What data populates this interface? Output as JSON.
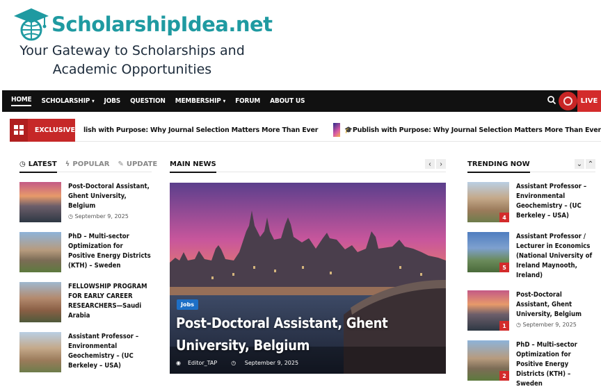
{
  "site": {
    "logo_text": "ScholarshipIdea.net",
    "tagline_line1": "Your Gateway to Scholarships and",
    "tagline_line2": "Academic Opportunities"
  },
  "nav": {
    "items": [
      "HOME",
      "SCHOLARSHIP",
      "JOBS",
      "QUESTION",
      "MEMBERSHIP",
      "FORUM",
      "ABOUT US"
    ],
    "live_label": "LIVE"
  },
  "ticker": {
    "badge": "EXCLUSIVE",
    "text1": "lish with Purpose: Why Journal Selection Matters More Than Ever",
    "text2": "Publish with Purpose: Why Journal Selection Matters More Than Ever"
  },
  "left": {
    "tabs": [
      "LATEST",
      "POPULAR",
      "UPDATE"
    ],
    "posts": [
      {
        "title": "Post-Doctoral Assistant, Ghent University, Belgium",
        "date": "September 9, 2025"
      },
      {
        "title": "PhD – Multi-sector Optimization for Positive Energy Districts (KTH) – Sweden",
        "date": ""
      },
      {
        "title": "FELLOWSHIP PROGRAM FOR EARLY CAREER RESEARCHERS—Saudi Arabia",
        "date": ""
      },
      {
        "title": "Assistant Professor – Environmental Geochemistry – (UC Berkeley – USA)",
        "date": ""
      }
    ]
  },
  "main": {
    "heading": "MAIN NEWS",
    "hero": {
      "category": "Jobs",
      "title": "Post-Doctoral Assistant, Ghent University, Belgium",
      "author": "Editor_TAP",
      "date": "September 9, 2025"
    }
  },
  "right": {
    "heading": "TRENDING NOW",
    "items": [
      {
        "rank": "4",
        "title": "Assistant Professor – Environmental Geochemistry – (UC Berkeley – USA)"
      },
      {
        "rank": "5",
        "title": "Assistant Professor / Lecturer in Economics (National University of Ireland Maynooth, Ireland)"
      },
      {
        "rank": "1",
        "title": "Post-Doctoral Assistant, Ghent University, Belgium",
        "date": "September 9, 2025"
      },
      {
        "rank": "2",
        "title": "PhD – Multi-sector Optimization for Positive Energy Districts (KTH) – Sweden"
      }
    ]
  },
  "colors": {
    "accent_red": "#d32b2b",
    "nav_bg": "#111111",
    "logo_teal": "#1f9aa1",
    "category_blue": "#1e6fc6"
  }
}
